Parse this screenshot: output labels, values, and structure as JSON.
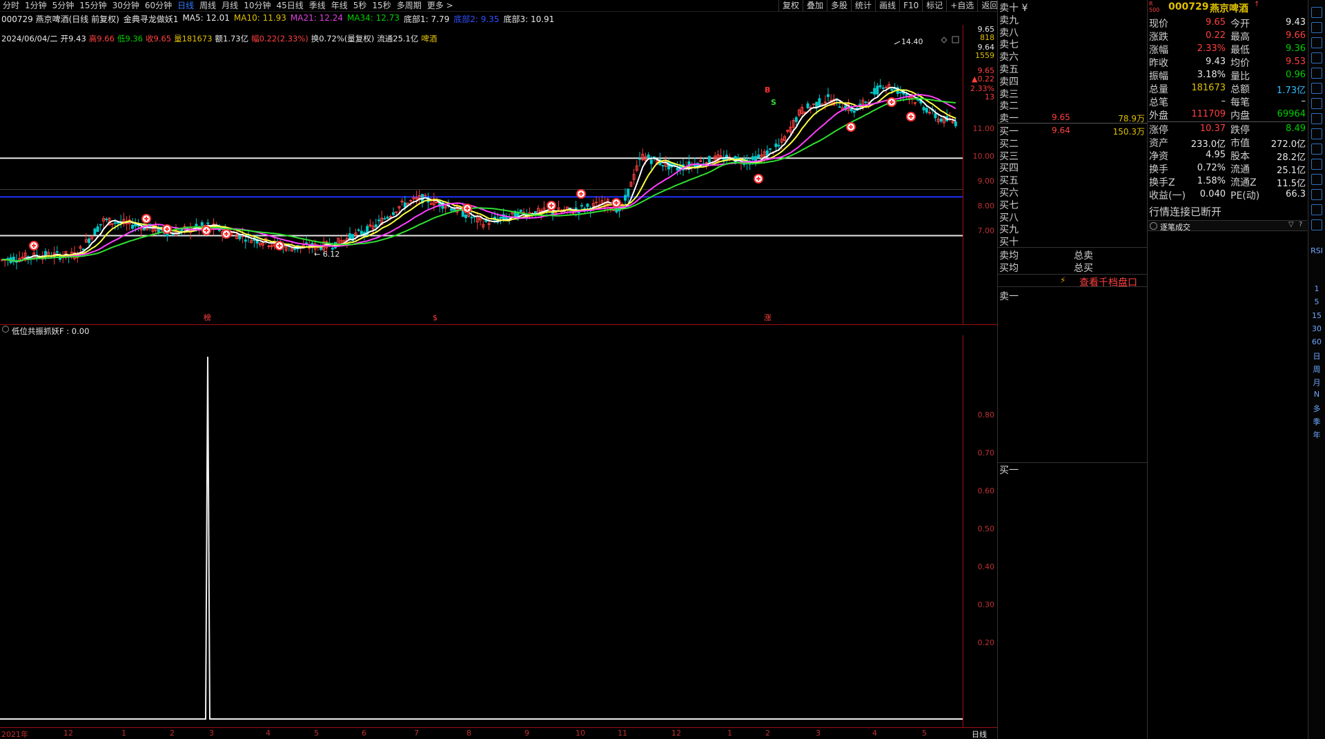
{
  "timeframes": [
    {
      "label": "分时",
      "active": false
    },
    {
      "label": "1分钟",
      "active": false
    },
    {
      "label": "5分钟",
      "active": false
    },
    {
      "label": "15分钟",
      "active": false
    },
    {
      "label": "30分钟",
      "active": false
    },
    {
      "label": "60分钟",
      "active": false
    },
    {
      "label": "日线",
      "active": true
    },
    {
      "label": "周线",
      "active": false
    },
    {
      "label": "月线",
      "active": false
    },
    {
      "label": "10分钟",
      "active": false
    },
    {
      "label": "45日线",
      "active": false
    },
    {
      "label": "季线",
      "active": false
    },
    {
      "label": "年线",
      "active": false
    },
    {
      "label": "5秒",
      "active": false
    },
    {
      "label": "15秒",
      "active": false
    },
    {
      "label": "多周期",
      "active": false
    },
    {
      "label": "更多 >",
      "active": false
    }
  ],
  "toolbar_right": [
    "复权",
    "叠加",
    "多股",
    "统计",
    "画线",
    "F10",
    "标记",
    "+自选",
    "返回"
  ],
  "ma_line": {
    "stock": "000729 燕京啤酒(日线 前复权)",
    "indicator": "金典寻龙做妖1",
    "ma5": "MA5: 12.01",
    "ma10": "MA10: 11.93",
    "ma21": "MA21: 12.24",
    "ma34": "MA34: 12.73",
    "bottom1": "底部1: 7.79",
    "bottom2": "底部2: 9.35",
    "bottom3": "底部3: 10.91"
  },
  "ohlc_line": {
    "date": "2024/06/04/二",
    "open": "开9.43",
    "high": "高9.66",
    "low": "低9.36",
    "close": "收9.65",
    "volume": "量181673",
    "amount": "额1.73亿",
    "range": "幅0.22(2.33%)",
    "turnover": "换0.72%(量复权)",
    "float": "流通25.1亿",
    "sector": "啤酒"
  },
  "main_axis": {
    "top_labels": [
      "9.65",
      "818",
      "9.64",
      "1559",
      "9.65",
      "▲0.22",
      "2.33%",
      "13"
    ],
    "price_ticks": [
      "11.00",
      "10.00",
      "9.00",
      "8.00",
      "7.00"
    ]
  },
  "chart_annotations": {
    "high_label": "14.40",
    "low_label": "6.12",
    "bottom_marks": [
      "榜",
      "$",
      "涨"
    ]
  },
  "indicator": {
    "title": "低位共振抓妖F : 0.00",
    "ticks": [
      "0.80",
      "0.70",
      "0.60",
      "0.50",
      "0.40",
      "0.30",
      "0.20"
    ]
  },
  "date_axis": {
    "labels": [
      "2021年",
      "12",
      "1",
      "2",
      "3",
      "4",
      "5",
      "6",
      "7",
      "8",
      "9",
      "10",
      "11",
      "12",
      "1",
      "2",
      "3",
      "4",
      "5"
    ],
    "period": "日线"
  },
  "orderbook": {
    "asks": [
      "卖十 ¥",
      "卖九",
      "卖八",
      "卖七",
      "卖六",
      "卖五",
      "卖四",
      "卖三",
      "卖二",
      "卖一"
    ],
    "ask1_price": "9.65",
    "ask1_vol": "78.9万",
    "bid1_price": "9.64",
    "bid1_vol": "150.3万",
    "bids": [
      "买一",
      "买二",
      "买三",
      "买四",
      "买五",
      "买六",
      "买七",
      "买八",
      "买九",
      "买十"
    ],
    "avg_sell": "卖均",
    "avg_buy": "买均",
    "total_sell": "总卖",
    "total_buy": "总买",
    "view_depth": "查看千档盘口",
    "sell_one_lower": "卖一",
    "buy_one_lower": "买一"
  },
  "quote": {
    "code": "000729",
    "name": "燕京啤酒",
    "rows": [
      {
        "l1": "现价",
        "v1": "9.65",
        "c1": "red",
        "l2": "今开",
        "v2": "9.43",
        "c2": "white"
      },
      {
        "l1": "涨跌",
        "v1": "0.22",
        "c1": "red",
        "l2": "最高",
        "v2": "9.66",
        "c2": "red"
      },
      {
        "l1": "涨幅",
        "v1": "2.33%",
        "c1": "red",
        "l2": "最低",
        "v2": "9.36",
        "c2": "green"
      },
      {
        "l1": "昨收",
        "v1": "9.43",
        "c1": "white",
        "l2": "均价",
        "v2": "9.53",
        "c2": "red"
      },
      {
        "l1": "振幅",
        "v1": "3.18%",
        "c1": "white",
        "l2": "量比",
        "v2": "0.96",
        "c2": "green"
      },
      {
        "l1": "总量",
        "v1": "181673",
        "c1": "yellow",
        "l2": "总额",
        "v2": "1.73亿",
        "c2": "cyan"
      },
      {
        "l1": "总笔",
        "v1": "–",
        "c1": "white",
        "l2": "每笔",
        "v2": "–",
        "c2": "white"
      },
      {
        "l1": "外盘",
        "v1": "111709",
        "c1": "red",
        "l2": "内盘",
        "v2": "69964",
        "c2": "green"
      },
      {
        "l1": "涨停",
        "v1": "10.37",
        "c1": "red",
        "l2": "跌停",
        "v2": "8.49",
        "c2": "green"
      },
      {
        "l1": "资产",
        "v1": "233.0亿",
        "c1": "white",
        "l2": "市值",
        "v2": "272.0亿",
        "c2": "white"
      },
      {
        "l1": "净资",
        "v1": "4.95",
        "c1": "white",
        "l2": "股本",
        "v2": "28.2亿",
        "c2": "white"
      },
      {
        "l1": "换手",
        "v1": "0.72%",
        "c1": "white",
        "l2": "流通",
        "v2": "25.1亿",
        "c2": "white"
      },
      {
        "l1": "换手Z",
        "v1": "1.58%",
        "c1": "white",
        "l2": "流通Z",
        "v2": "11.5亿",
        "c2": "white"
      },
      {
        "l1": "收益(一)",
        "v1": "0.040",
        "c1": "white",
        "l2": "PE(动)",
        "v2": "66.3",
        "c2": "white"
      }
    ],
    "status": "行情连接已断开",
    "trades_title": "逐笔成交"
  },
  "sidebar_text": [
    "RSI",
    "1",
    "5",
    "15",
    "30",
    "60",
    "日",
    "周",
    "月",
    "N",
    "多",
    "季",
    "年"
  ],
  "colors": {
    "up": "#ff4040",
    "down": "#00d000",
    "ma5": "#ffffff",
    "ma10": "#ffff40",
    "ma21": "#ff40ff",
    "ma34": "#30e030",
    "axis": "#a01010",
    "active_tab": "#2f7bff"
  }
}
